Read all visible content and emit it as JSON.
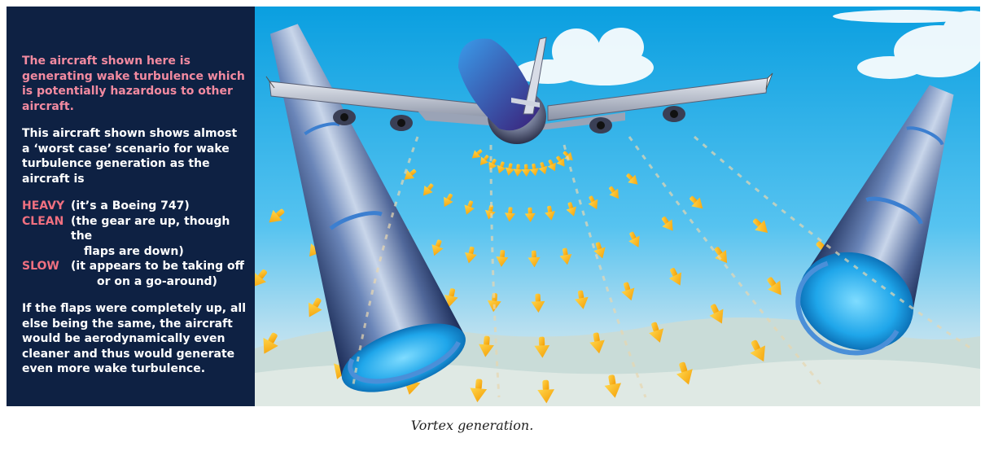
{
  "panel": {
    "intro": "The aircraft shown here is generating wake turbulence which is potentially hazardous to other aircraft.",
    "para2": "This aircraft shown shows almost a ‘worst case’ scenario for wake turbulence generation as the aircraft is",
    "conditions": [
      {
        "keyword": "HEAVY",
        "desc": "(it’s a Boeing 747)",
        "cont": ""
      },
      {
        "keyword": "CLEAN",
        "desc": "(the gear are up, though the",
        "cont": "flaps are down)"
      },
      {
        "keyword": "SLOW",
        "desc": "(it appears to be taking off",
        "cont": "or on a go-around)"
      }
    ],
    "para3": "If the flaps were completely up, all else being the same, the aircraft would be aerodynamically even cleaner and thus would generate even more wake turbulence."
  },
  "caption": "Vortex generation.",
  "colors": {
    "panel_bg": "#0e2143",
    "highlight_text": "#f28aa0",
    "keyword_text": "#f07080",
    "sky_top": "#0a9fe0",
    "arrow": "#f5b800"
  }
}
